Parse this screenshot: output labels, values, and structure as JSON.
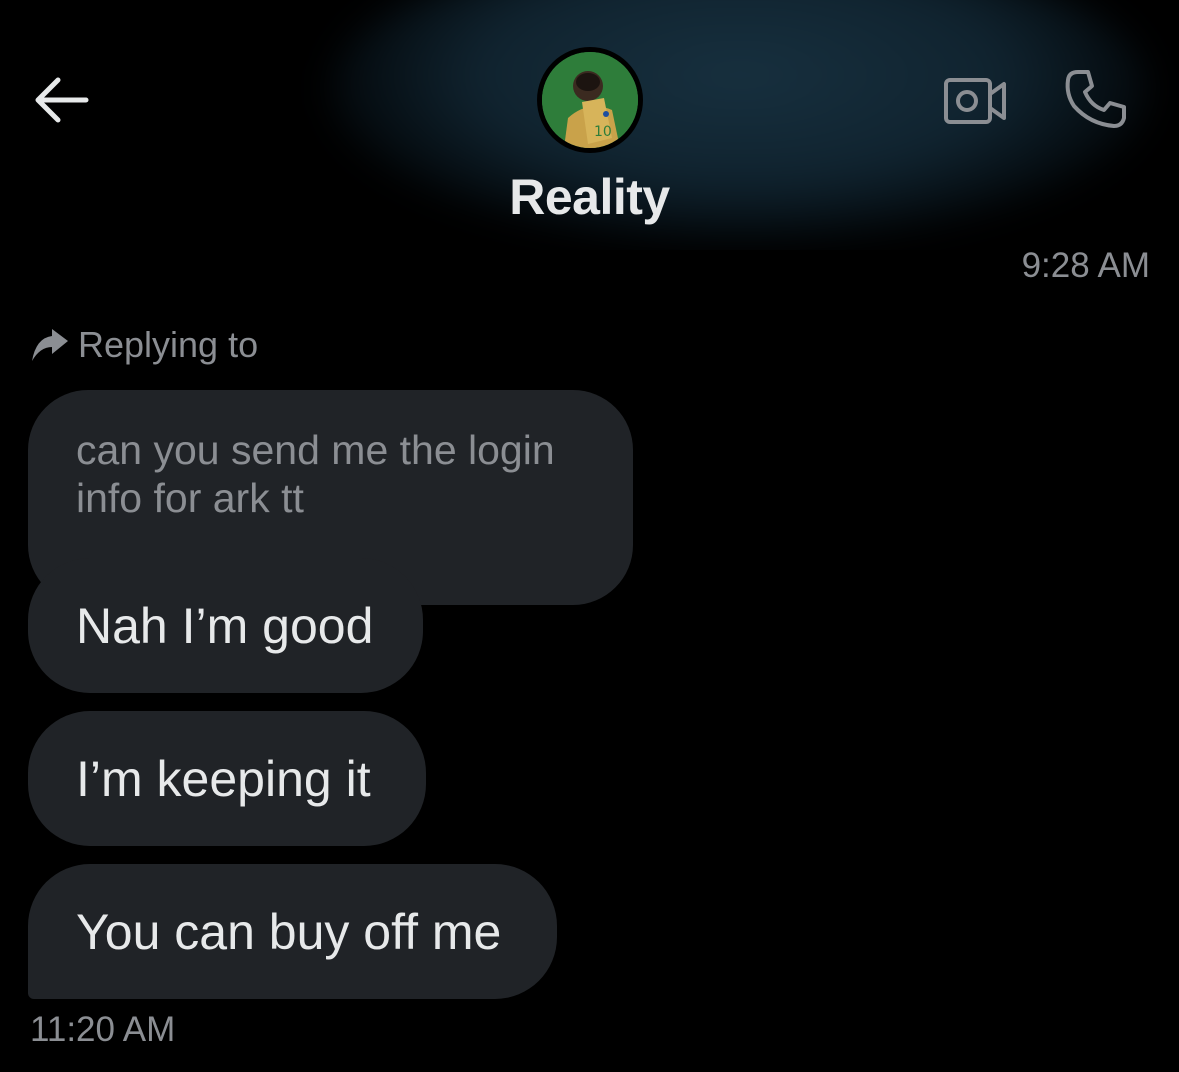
{
  "header": {
    "contact_name": "Reality"
  },
  "conversation": {
    "timestamp_top": "9:28 AM",
    "reply_label": "Replying to",
    "quoted_message": "can you send me the login info for ark tt",
    "messages": [
      {
        "text": "Nah I’m good"
      },
      {
        "text": "I’m keeping it"
      },
      {
        "text": "You can buy off me"
      }
    ],
    "timestamp_bottom": "11:20 AM"
  },
  "colors": {
    "background": "#000000",
    "bubble": "#202327",
    "primary_text": "#e7e9ea",
    "secondary_text": "#8b8e93",
    "header_glow": "#17303f"
  },
  "icons": [
    "back-arrow-icon",
    "video-camera-icon",
    "phone-icon",
    "reply-arrow-icon"
  ]
}
